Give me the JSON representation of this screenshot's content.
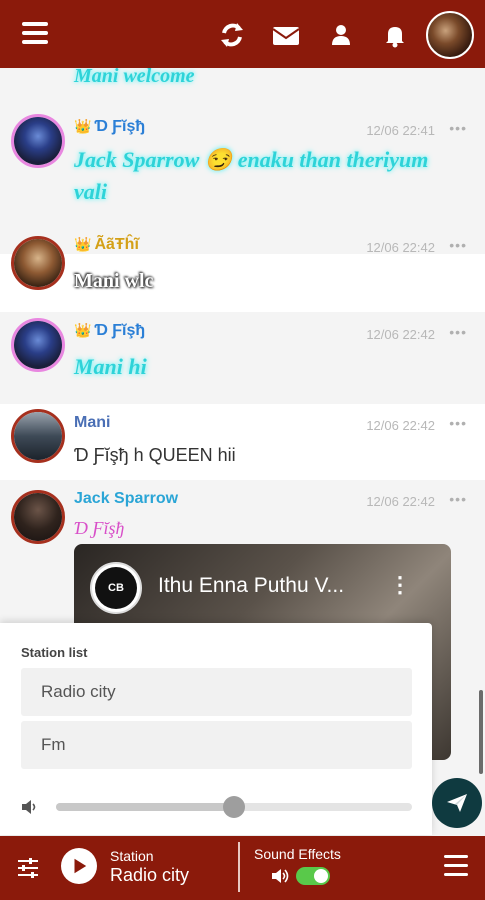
{
  "colors": {
    "bar": "#8b1a0b",
    "glow": "#2ed3d8",
    "send_button": "#0f3a40",
    "toggle_on": "#59c94a"
  },
  "header": {
    "icons": [
      "menu-icon",
      "refresh-icon",
      "mail-icon",
      "user-icon",
      "bell-icon"
    ]
  },
  "messages": [
    {
      "user": "",
      "time": "",
      "text": "Mani welcome"
    },
    {
      "user": "Ɗ Ƒĭşђ",
      "time": "12/06 22:41",
      "text": "Jack Sparrow 😏 enaku than theriyum vali"
    },
    {
      "user": "ÃãŦĥĩ",
      "time": "12/06 22:42",
      "text": "Mani wlc"
    },
    {
      "user": "Ɗ Ƒĭşђ",
      "time": "12/06 22:42",
      "text": "Mani hi"
    },
    {
      "user": "Mani",
      "time": "12/06 22:42",
      "text": "Ɗ Ƒĭşђ h QUEEN hii"
    },
    {
      "user": "Jack Sparrow",
      "time": "12/06 22:42",
      "text": "Ɗ Ƒĭşђ"
    }
  ],
  "video": {
    "title": "Ithu Enna Puthu V...",
    "channel_logo": "CB"
  },
  "station_panel": {
    "title": "Station list",
    "items": [
      "Radio city",
      "Fm"
    ],
    "volume": 0.5
  },
  "player": {
    "station_label": "Station",
    "station_name": "Radio city",
    "sound_effects_label": "Sound Effects",
    "sound_effects_on": true
  }
}
